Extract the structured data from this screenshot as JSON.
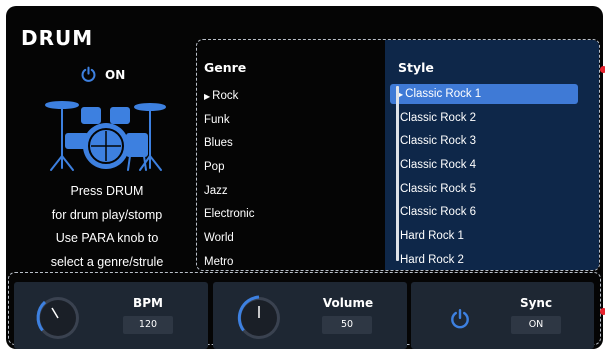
{
  "header": {
    "title": "DRUM",
    "power_state": "ON"
  },
  "instructions": [
    "Press DRUM",
    "for drum play/stomp",
    "Use PARA knob to",
    "select a genre/strule"
  ],
  "genre": {
    "header": "Genre",
    "selected_marker": "▶",
    "items": [
      "Rock",
      "Funk",
      "Blues",
      "Pop",
      "Jazz",
      "Electronic",
      "World",
      "Metro"
    ],
    "selected_index": 0
  },
  "style": {
    "header": "Style",
    "selected_marker": "▶",
    "items": [
      "Classic Rock 1",
      "Classic Rock 2",
      "Classic Rock 3",
      "Classic Rock 4",
      "Classic Rock 5",
      "Classic Rock 6",
      "Hard Rock 1",
      "Hard Rock 2"
    ],
    "selected_index": 0
  },
  "controls": {
    "bpm": {
      "label": "BPM",
      "value": "120"
    },
    "volume": {
      "label": "Volume",
      "value": "50"
    },
    "sync": {
      "label": "Sync",
      "value": "ON"
    }
  },
  "colors": {
    "accent_blue": "#3f7ad6",
    "style_panel_bg": "#0e2749",
    "indicator_red": "#e8242f",
    "icon_blue": "#3d80e0"
  },
  "icons": {
    "power": "power-icon",
    "drum_kit": "drum-kit-icon",
    "sync_power": "power-icon"
  }
}
